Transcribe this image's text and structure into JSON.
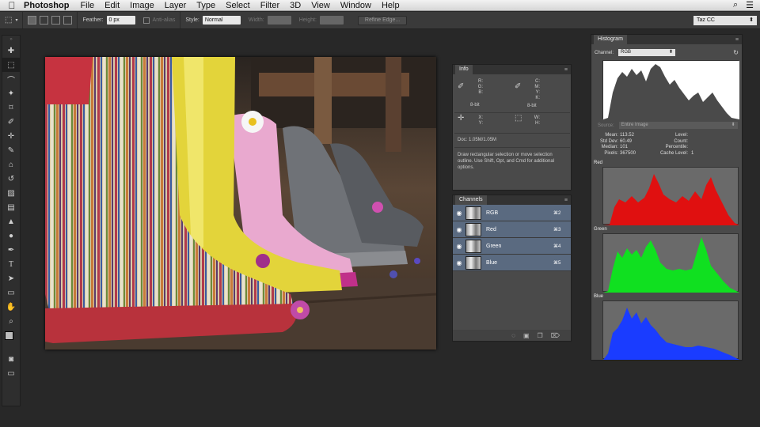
{
  "menubar": {
    "app": "Photoshop",
    "items": [
      "File",
      "Edit",
      "Image",
      "Layer",
      "Type",
      "Select",
      "Filter",
      "3D",
      "View",
      "Window",
      "Help"
    ]
  },
  "options": {
    "feather_label": "Feather:",
    "feather_value": "0 px",
    "antialias_label": "Anti-alias",
    "style_label": "Style:",
    "style_value": "Normal",
    "width_label": "Width:",
    "height_label": "Height:",
    "refine_edge": "Refine Edge...",
    "workspace": "Taz CC"
  },
  "info": {
    "tab": "Info",
    "rgb_labels": "R:\nG:\nB:",
    "bit1": "8-bit",
    "cmyk_labels": "C:\nM:\nY:\nK:",
    "bit2": "8-bit",
    "xy_labels": "X:\nY:",
    "wh_labels": "W:\nH:",
    "doc": "Doc: 1.05M/1.05M",
    "hint": "Draw rectangular selection or move selection outline.  Use Shift, Opt, and Cmd for additional options."
  },
  "channels": {
    "tab": "Channels",
    "rows": [
      {
        "name": "RGB",
        "key": "⌘2"
      },
      {
        "name": "Red",
        "key": "⌘3"
      },
      {
        "name": "Green",
        "key": "⌘4"
      },
      {
        "name": "Blue",
        "key": "⌘5"
      }
    ]
  },
  "histogram": {
    "tab": "Histogram",
    "channel_label": "Channel:",
    "channel_value": "RGB",
    "source_label": "Source:",
    "source_value": "Entire Image",
    "stats_left_labels": [
      "Mean:",
      "Std Dev:",
      "Median:",
      "Pixels:"
    ],
    "stats_left_values": [
      "113.52",
      "60.49",
      "101",
      "367500"
    ],
    "stats_right_labels": [
      "Level:",
      "Count:",
      "Percentile:",
      "Cache Level:"
    ],
    "stats_right_values": [
      "",
      "",
      "",
      "1"
    ],
    "red_label": "Red",
    "green_label": "Green",
    "blue_label": "Blue",
    "colors": {
      "rgb": "#ffffff",
      "red": "#e01010",
      "green": "#10e020",
      "blue": "#1a3cff"
    }
  },
  "icons": [
    "apple-icon",
    "search-icon",
    "list-icon",
    "marquee-icon",
    "move-icon",
    "eye-icon"
  ]
}
